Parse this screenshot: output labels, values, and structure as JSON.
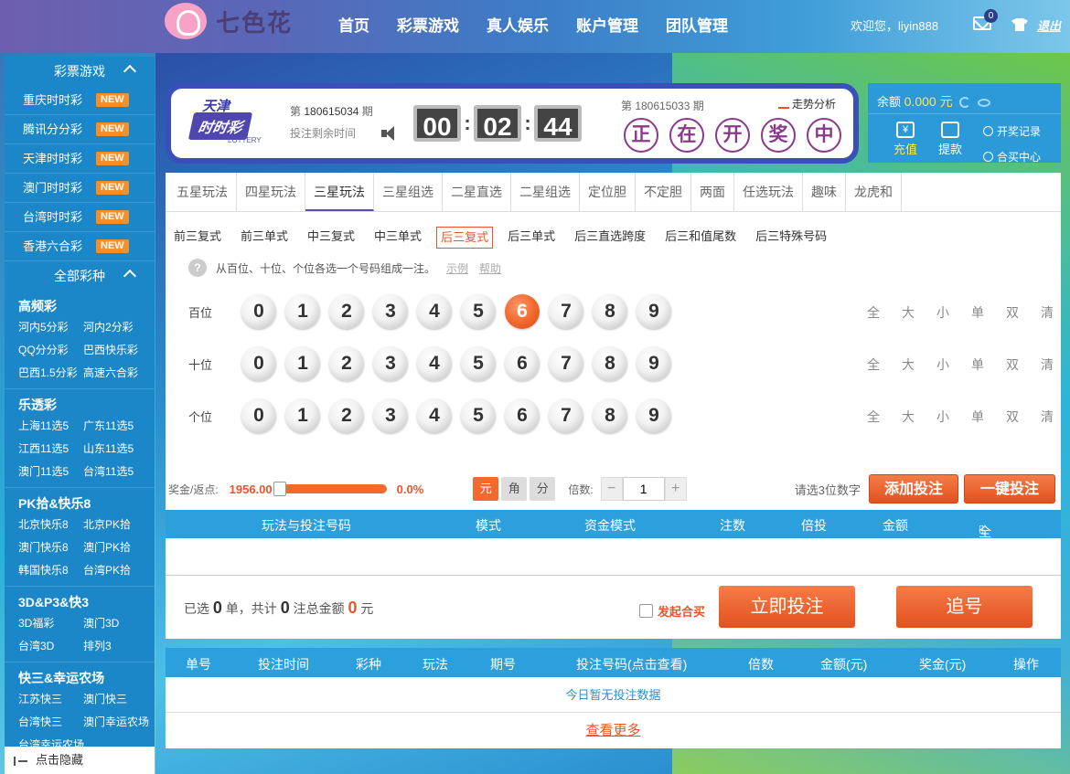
{
  "brand": {
    "name": "七色花"
  },
  "nav": [
    "首页",
    "彩票游戏",
    "真人娱乐",
    "账户管理",
    "团队管理"
  ],
  "user": {
    "welcome": "欢迎您，liyin888",
    "mail_count": "0",
    "logout": "退出"
  },
  "sidebar": {
    "lottery_head": "彩票游戏",
    "hot": [
      {
        "label": "重庆时时彩",
        "badge": "NEW"
      },
      {
        "label": "腾讯分分彩",
        "badge": "NEW"
      },
      {
        "label": "天津时时彩",
        "badge": "NEW"
      },
      {
        "label": "澳门时时彩",
        "badge": "NEW"
      },
      {
        "label": "台湾时时彩",
        "badge": "NEW"
      },
      {
        "label": "香港六合彩",
        "badge": "NEW"
      }
    ],
    "all_head": "全部彩种",
    "groups": [
      {
        "title": "高频彩",
        "items": [
          "河内5分彩",
          "河内2分彩",
          "QQ分分彩",
          "巴西快乐彩",
          "巴西1.5分彩",
          "高速六合彩"
        ]
      },
      {
        "title": "乐透彩",
        "items": [
          "上海11选5",
          "广东11选5",
          "江西11选5",
          "山东11选5",
          "澳门11选5",
          "台湾11选5"
        ]
      },
      {
        "title": "PK拾&快乐8",
        "items": [
          "北京快乐8",
          "北京PK拾",
          "澳门快乐8",
          "澳门PK拾",
          "韩国快乐8",
          "台湾PK拾"
        ]
      },
      {
        "title": "3D&P3&快3",
        "items": [
          "3D福彩",
          "澳门3D",
          "台湾3D",
          "排列3"
        ]
      },
      {
        "title": "快三&幸运农场",
        "items": [
          "江苏快三",
          "澳门快三",
          "台湾快三",
          "澳门幸运农场",
          "台湾幸运农场"
        ]
      }
    ],
    "hide": "点击隐藏"
  },
  "game": {
    "logo_top": "天津",
    "logo_main": "时时彩",
    "logo_sub": "LOTTERY",
    "issue_prefix": "第",
    "issue": "180615034",
    "issue_suffix": "期",
    "remain": "投注剩余时间",
    "timer": [
      "00",
      "02",
      "44"
    ],
    "last_issue_text": "第 180615033 期",
    "trend": "走势分析",
    "draw": [
      "正",
      "在",
      "开",
      "奖",
      "中"
    ]
  },
  "account": {
    "balance_label": "余额",
    "balance": "0.000 元",
    "deposit": "充值",
    "withdraw": "提款",
    "records": "开奖记录",
    "joint_center": "合买中心"
  },
  "tabs": [
    "五星玩法",
    "四星玩法",
    "三星玩法",
    "三星组选",
    "二星直选",
    "二星组选",
    "定位胆",
    "不定胆",
    "两面",
    "任选玩法",
    "趣味",
    "龙虎和"
  ],
  "active_tab": 2,
  "subtabs": [
    "前三复式",
    "前三单式",
    "中三复式",
    "中三单式",
    "后三复式",
    "后三单式",
    "后三直选跨度",
    "后三和值尾数",
    "后三特殊号码"
  ],
  "active_sub": 4,
  "hint": {
    "text": "从百位、十位、个位各选一个号码组成一注。",
    "example": "示例",
    "help": "帮助"
  },
  "rows": [
    {
      "label": "百位",
      "selected": 6
    },
    {
      "label": "十位",
      "selected": null
    },
    {
      "label": "个位",
      "selected": null
    }
  ],
  "digits": [
    "0",
    "1",
    "2",
    "3",
    "4",
    "5",
    "6",
    "7",
    "8",
    "9"
  ],
  "quick": [
    "全",
    "大",
    "小",
    "单",
    "双",
    "清"
  ],
  "bet": {
    "prize_label": "奖金/返点:",
    "odds": "1956.00",
    "rebate": "0.0%",
    "units": [
      "元",
      "角",
      "分"
    ],
    "mult_label": "倍数:",
    "mult": "1",
    "need": "请选3位数字",
    "add": "添加投注",
    "one_click": "一键投注"
  },
  "cart_headers": [
    "玩法与投注号码",
    "模式",
    "资金模式",
    "注数",
    "倍投",
    "金额",
    "全删"
  ],
  "summary": {
    "p1": "已选",
    "count": "0",
    "p2": "单，共计",
    "notes": "0",
    "p3": "注总金额",
    "amount": "0",
    "p4": "元"
  },
  "joint": "发起合买",
  "submit": "立即投注",
  "chase": "追号",
  "records": {
    "headers": [
      "单号",
      "投注时间",
      "彩种",
      "玩法",
      "期号",
      "投注号码(点击查看)",
      "倍数",
      "金额(元)",
      "奖金(元)",
      "操作"
    ],
    "empty": "今日暂无投注数据",
    "more": "查看更多"
  },
  "colors": {
    "accent": "#f26a2e",
    "blue": "#2ca0dc",
    "sidebar": "#1b87c9",
    "panel_border": "#3a50b8"
  }
}
